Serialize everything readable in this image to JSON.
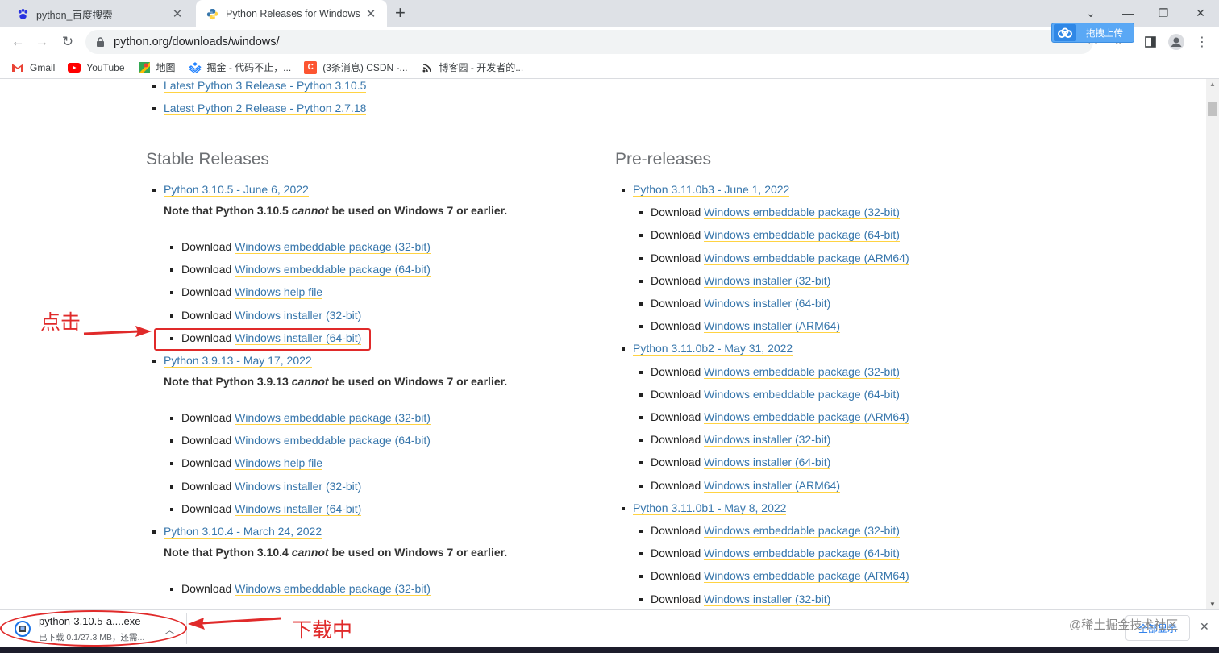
{
  "tabs": [
    {
      "title": "python_百度搜索",
      "active": false
    },
    {
      "title": "Python Releases for Windows",
      "active": true
    }
  ],
  "address_bar": {
    "url": "python.org/downloads/windows/"
  },
  "baidu_extension": {
    "label": "拖拽上传"
  },
  "bookmarks": [
    {
      "label": "Gmail",
      "icon": "gmail-icon"
    },
    {
      "label": "YouTube",
      "icon": "youtube-icon"
    },
    {
      "label": "地图",
      "icon": "maps-icon"
    },
    {
      "label": "掘金 - 代码不止，...",
      "icon": "juejin-icon"
    },
    {
      "label": "(3条消息) CSDN -...",
      "icon": "csdn-icon"
    },
    {
      "label": "博客园 - 开发者的...",
      "icon": "cnblogs-icon"
    }
  ],
  "top_links": [
    {
      "link": "Latest Python 3 Release - Python 3.10.5"
    },
    {
      "link": "Latest Python 2 Release - Python 2.7.18"
    }
  ],
  "stable": {
    "title": "Stable Releases",
    "releases": [
      {
        "link": "Python 3.10.5 - June 6, 2022",
        "note": {
          "pre": "Note that Python 3.10.5 ",
          "em": "cannot",
          "post": " be used on Windows 7 or earlier."
        },
        "files": [
          {
            "prefix": "Download ",
            "link": "Windows embeddable package (32-bit)"
          },
          {
            "prefix": "Download ",
            "link": "Windows embeddable package (64-bit)"
          },
          {
            "prefix": "Download ",
            "link": "Windows help file"
          },
          {
            "prefix": "Download ",
            "link": "Windows installer (32-bit)"
          },
          {
            "prefix": "Download ",
            "link": "Windows installer (64-bit)"
          }
        ]
      },
      {
        "link": "Python 3.9.13 - May 17, 2022",
        "note": {
          "pre": "Note that Python 3.9.13 ",
          "em": "cannot",
          "post": " be used on Windows 7 or earlier."
        },
        "files": [
          {
            "prefix": "Download ",
            "link": "Windows embeddable package (32-bit)"
          },
          {
            "prefix": "Download ",
            "link": "Windows embeddable package (64-bit)"
          },
          {
            "prefix": "Download ",
            "link": "Windows help file"
          },
          {
            "prefix": "Download ",
            "link": "Windows installer (32-bit)"
          },
          {
            "prefix": "Download ",
            "link": "Windows installer (64-bit)"
          }
        ]
      },
      {
        "link": "Python 3.10.4 - March 24, 2022",
        "note": {
          "pre": "Note that Python 3.10.4 ",
          "em": "cannot",
          "post": " be used on Windows 7 or earlier."
        },
        "files": [
          {
            "prefix": "Download ",
            "link": "Windows embeddable package (32-bit)"
          }
        ]
      }
    ]
  },
  "pre": {
    "title": "Pre-releases",
    "releases": [
      {
        "link": "Python 3.11.0b3 - June 1, 2022",
        "files": [
          {
            "prefix": "Download ",
            "link": "Windows embeddable package (32-bit)"
          },
          {
            "prefix": "Download ",
            "link": "Windows embeddable package (64-bit)"
          },
          {
            "prefix": "Download ",
            "link": "Windows embeddable package (ARM64)"
          },
          {
            "prefix": "Download ",
            "link": "Windows installer (32-bit)"
          },
          {
            "prefix": "Download ",
            "link": "Windows installer (64-bit)"
          },
          {
            "prefix": "Download ",
            "link": "Windows installer (ARM64)"
          }
        ]
      },
      {
        "link": "Python 3.11.0b2 - May 31, 2022",
        "files": [
          {
            "prefix": "Download ",
            "link": "Windows embeddable package (32-bit)"
          },
          {
            "prefix": "Download ",
            "link": "Windows embeddable package (64-bit)"
          },
          {
            "prefix": "Download ",
            "link": "Windows embeddable package (ARM64)"
          },
          {
            "prefix": "Download ",
            "link": "Windows installer (32-bit)"
          },
          {
            "prefix": "Download ",
            "link": "Windows installer (64-bit)"
          },
          {
            "prefix": "Download ",
            "link": "Windows installer (ARM64)"
          }
        ]
      },
      {
        "link": "Python 3.11.0b1 - May 8, 2022",
        "files": [
          {
            "prefix": "Download ",
            "link": "Windows embeddable package (32-bit)"
          },
          {
            "prefix": "Download ",
            "link": "Windows embeddable package (64-bit)"
          },
          {
            "prefix": "Download ",
            "link": "Windows embeddable package (ARM64)"
          },
          {
            "prefix": "Download ",
            "link": "Windows installer (32-bit)"
          }
        ]
      }
    ]
  },
  "download_bar": {
    "filename": "python-3.10.5-a....exe",
    "status": "已下载 0.1/27.3 MB，还需...",
    "show_all": "全部显示"
  },
  "annotations": {
    "click_label": "点击",
    "downloading_label": "下载中"
  },
  "watermark": "@稀土掘金技术社区",
  "colors": {
    "link": "#3776ab",
    "link_underline": "#ffd343",
    "annotation": "#e02a2a"
  }
}
